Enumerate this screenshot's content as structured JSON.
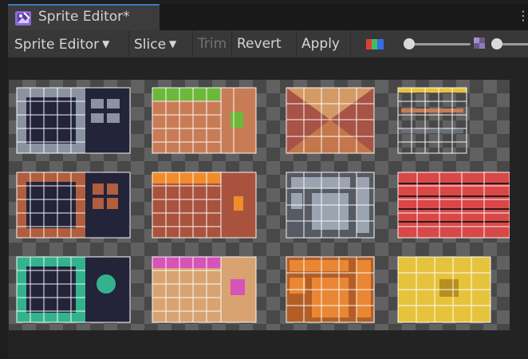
{
  "tab": {
    "title": "Sprite Editor*",
    "icon": "sprite-editor-icon",
    "accent": "#3a79bb"
  },
  "menu": {
    "icon": "kebab-menu-icon",
    "glyph": "⋮"
  },
  "toolbar": {
    "sprite_editor_label": "Sprite Editor",
    "slice_label": "Slice",
    "trim_label": "Trim",
    "revert_label": "Revert",
    "apply_label": "Apply",
    "caret": "▼",
    "trim_enabled": false
  },
  "sprite_sheet": {
    "tilesets": [
      {
        "frame": "stone",
        "top": "none"
      },
      {
        "frame": "dirt",
        "top": "grass"
      },
      {
        "frame": "roof",
        "top": "none"
      },
      {
        "frame": "rail",
        "top": "none"
      },
      {
        "frame": "wood",
        "top": "none"
      },
      {
        "frame": "dirt",
        "top": "lava"
      },
      {
        "frame": "metal",
        "top": "none"
      },
      {
        "frame": "brick",
        "top": "none"
      },
      {
        "frame": "green-gem",
        "top": "none"
      },
      {
        "frame": "sand",
        "top": "pink-slime"
      },
      {
        "frame": "orange-block",
        "top": "none"
      },
      {
        "frame": "gold-block",
        "top": "none"
      }
    ],
    "colors": {
      "checker_light": "#616161",
      "checker_dark": "#484848",
      "dark_interior": "#23233a",
      "stone": "#8b93a1",
      "grass": "#6cb83a",
      "dirt": "#c87c55",
      "roof": "#a75345",
      "rail": "#6a6f78",
      "wood": "#b15e3e",
      "lava": "#f18c2c",
      "metal": "#9ba4b0",
      "brick": "#d94848",
      "green_gem": "#33b38d",
      "pink_slime": "#d653b8",
      "sand": "#d8a371",
      "orange": "#e98734",
      "gold": "#e6c33d"
    }
  }
}
